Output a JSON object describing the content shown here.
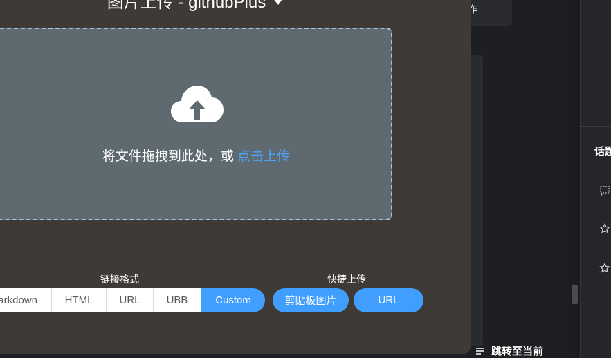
{
  "modal": {
    "title": "图片上传 - githubPlus",
    "drop_text": "将文件拖拽到此处，或",
    "drop_link": "点击上传",
    "link_format_label": "链接格式",
    "quick_upload_label": "快捷上传",
    "formats": [
      {
        "label": "Markdown",
        "visible": "arkdown"
      },
      {
        "label": "HTML"
      },
      {
        "label": "URL"
      },
      {
        "label": "UBB"
      },
      {
        "label": "Custom",
        "active": true
      }
    ],
    "quick": {
      "clipboard_label": "剪贴板图片",
      "url_label": "URL"
    }
  },
  "background": {
    "top_card_text": "作",
    "topic_heading": "话题",
    "jump_label": "跳转至当前"
  },
  "colors": {
    "modal_bg": "#3f3a35",
    "dropzone_bg": "#5e6a70",
    "accent": "#409eff",
    "link": "#4ea3f4"
  },
  "icons": [
    "caret-down-icon",
    "cloud-upload-icon",
    "comment-icon",
    "star-icon",
    "list-icon"
  ]
}
